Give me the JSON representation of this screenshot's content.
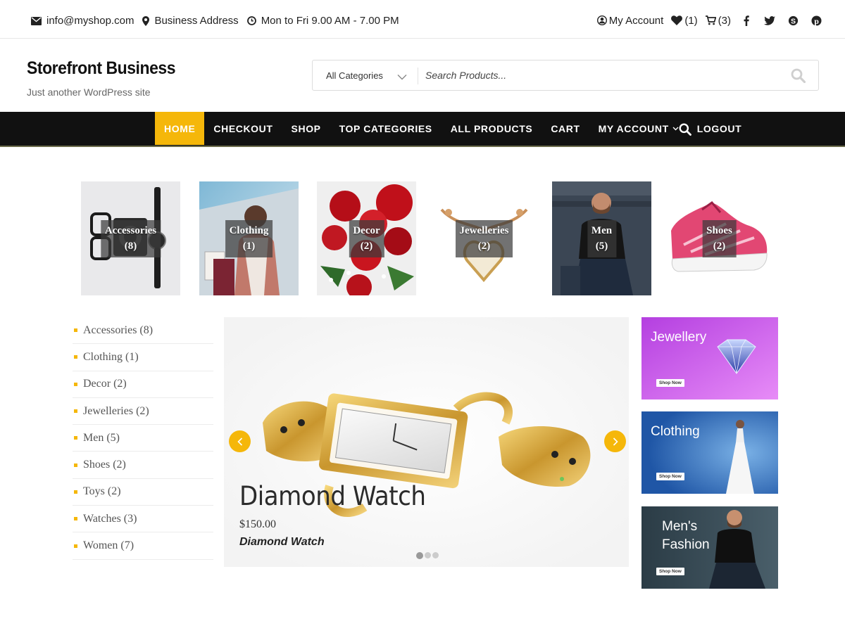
{
  "topbar": {
    "email": "info@myshop.com",
    "address": "Business Address",
    "hours": "Mon to Fri 9.00 AM - 7.00 PM",
    "account": "My Account",
    "wishlist_count": "(1)",
    "cart_count": "(3)",
    "social": [
      "facebook-icon",
      "twitter-icon",
      "skype-icon",
      "pinterest-icon"
    ]
  },
  "header": {
    "site_title": "Storefront Business",
    "tagline": "Just another WordPress site"
  },
  "search": {
    "category_selected": "All Categories",
    "placeholder": "Search Products..."
  },
  "nav": {
    "items": [
      {
        "label": "HOME",
        "active": true
      },
      {
        "label": "CHECKOUT"
      },
      {
        "label": "SHOP"
      },
      {
        "label": "TOP CATEGORIES"
      },
      {
        "label": "ALL PRODUCTS"
      },
      {
        "label": "CART"
      },
      {
        "label": "MY ACCOUNT",
        "dropdown": true
      },
      {
        "label": "LOGOUT"
      }
    ]
  },
  "category_tiles": [
    {
      "name": "Accessories",
      "count": "(8)"
    },
    {
      "name": "Clothing",
      "count": "(1)"
    },
    {
      "name": "Decor",
      "count": "(2)"
    },
    {
      "name": "Jewelleries",
      "count": "(2)"
    },
    {
      "name": "Men",
      "count": "(5)"
    },
    {
      "name": "Shoes",
      "count": "(2)"
    }
  ],
  "sidebar_categories": [
    {
      "label": "Accessories (8)"
    },
    {
      "label": "Clothing (1)"
    },
    {
      "label": "Decor (2)"
    },
    {
      "label": "Jewelleries (2)"
    },
    {
      "label": "Men (5)"
    },
    {
      "label": "Shoes (2)"
    },
    {
      "label": "Toys (2)"
    },
    {
      "label": "Watches (3)"
    },
    {
      "label": "Women (7)"
    }
  ],
  "slider": {
    "title": "Diamond Watch",
    "price": "$150.00",
    "subtitle": "Diamond Watch",
    "dots": 3,
    "active_dot": 1
  },
  "banners": [
    {
      "title": "Jewellery",
      "button": "Shop Now"
    },
    {
      "title": "Clothing",
      "button": "Shop Now"
    },
    {
      "title_line1": "Men's",
      "title_line2": "Fashion",
      "button": "Shop Now"
    }
  ],
  "colors": {
    "accent": "#f5b70a",
    "nav_bg": "#111111"
  }
}
